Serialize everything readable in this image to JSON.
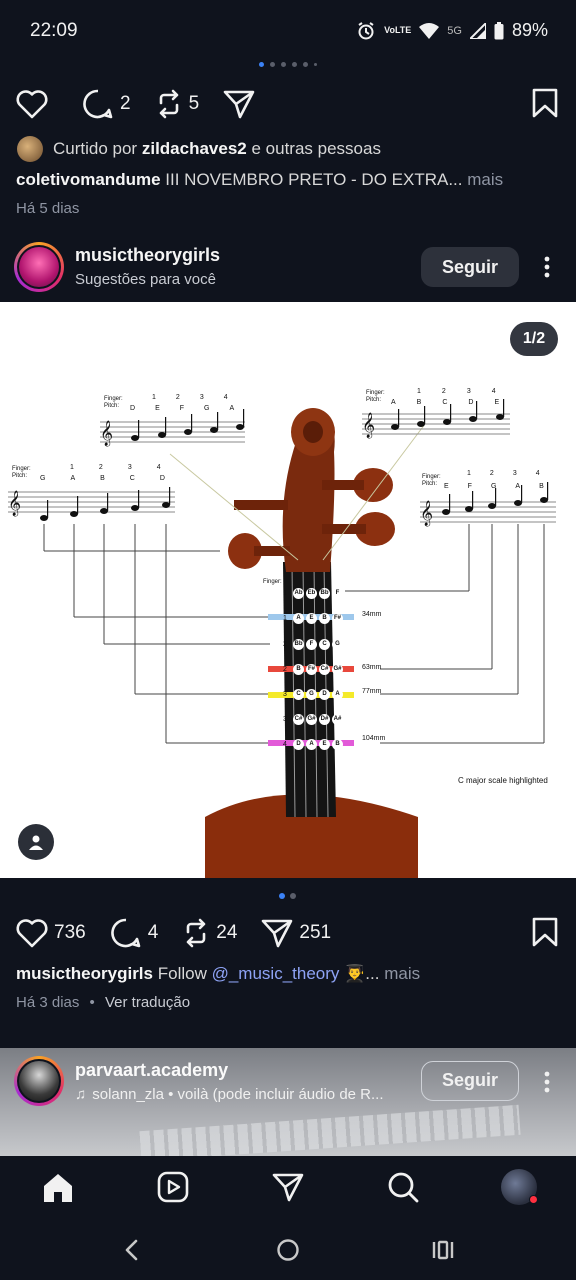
{
  "status": {
    "time": "22:09",
    "network": "5G",
    "battery": "89%",
    "volte": "VoLTE"
  },
  "carousel_top": {
    "dots": 6,
    "active": 0
  },
  "post1": {
    "comments": "2",
    "reposts": "5",
    "liked_by_prefix": "Curtido por",
    "liked_by_user": "zildachaves2",
    "liked_by_suffix": "e outras pessoas",
    "caption_user": "coletivomandume",
    "caption_text": "III NOVEMBRO PRETO - DO EXTRA...",
    "more": "mais",
    "time": "Há 5 dias"
  },
  "post2": {
    "username": "musictheorygirls",
    "subtitle": "Sugestões para você",
    "follow_label": "Seguir",
    "page_badge": "1/2",
    "likes": "736",
    "comments": "4",
    "reposts": "24",
    "shares": "251",
    "caption_user": "musictheorygirls",
    "caption_text": "Follow",
    "caption_mention": "@_music_theory",
    "caption_emoji": "👨‍🎓...",
    "more": "mais",
    "time": "Há 3 dias",
    "translate": "Ver tradução",
    "carousel_dots": 2,
    "carousel_active": 0,
    "image": {
      "staff_labels": {
        "finger": "Finger:",
        "pitch": "Pitch:"
      },
      "staff_tl": {
        "fingers": [
          "1",
          "2",
          "3",
          "4"
        ],
        "pitches": [
          "D",
          "E",
          "F",
          "G",
          "A"
        ]
      },
      "staff_ml": {
        "fingers": [
          "1",
          "2",
          "3",
          "4"
        ],
        "pitches": [
          "G",
          "A",
          "B",
          "C",
          "D"
        ]
      },
      "staff_tr": {
        "fingers": [
          "1",
          "2",
          "3",
          "4"
        ],
        "pitches": [
          "A",
          "B",
          "C",
          "D",
          "E"
        ]
      },
      "staff_mr": {
        "fingers": [
          "1",
          "2",
          "3",
          "4"
        ],
        "pitches": [
          "E",
          "F",
          "G",
          "A",
          "B"
        ]
      },
      "finger_row_label": "Finger:",
      "fingerboard_rows": [
        {
          "finger": "1",
          "notes": [
            "Ab",
            "Eb",
            "Bb",
            "F"
          ],
          "color": "#bfbfbf"
        },
        {
          "finger": "1",
          "notes": [
            "A",
            "E",
            "B",
            "F#"
          ],
          "color": "#9ec8ec"
        },
        {
          "finger": "2",
          "notes": [
            "Bb",
            "F",
            "C",
            "G"
          ],
          "color": "#bfbfbf"
        },
        {
          "finger": "2",
          "notes": [
            "B",
            "F#",
            "C#",
            "G#"
          ],
          "color": "#e8483c"
        },
        {
          "finger": "3",
          "notes": [
            "C",
            "G",
            "D",
            "A"
          ],
          "color": "#f4ea2a"
        },
        {
          "finger": "3",
          "notes": [
            "C#",
            "G#",
            "D#",
            "A#"
          ],
          "color": "#bfbfbf"
        },
        {
          "finger": "4",
          "notes": [
            "D",
            "A",
            "E",
            "B"
          ],
          "color": "#e25ad8"
        }
      ],
      "measurements": [
        "34mm",
        "63mm",
        "77mm",
        "104mm"
      ],
      "note": "C major scale highlighted"
    }
  },
  "post3": {
    "username": "parvaart.academy",
    "audio": "solann_zla • voilà (pode incluir áudio de R...",
    "follow_label": "Seguir"
  },
  "nav": [
    "home",
    "reels",
    "send",
    "search",
    "profile"
  ]
}
